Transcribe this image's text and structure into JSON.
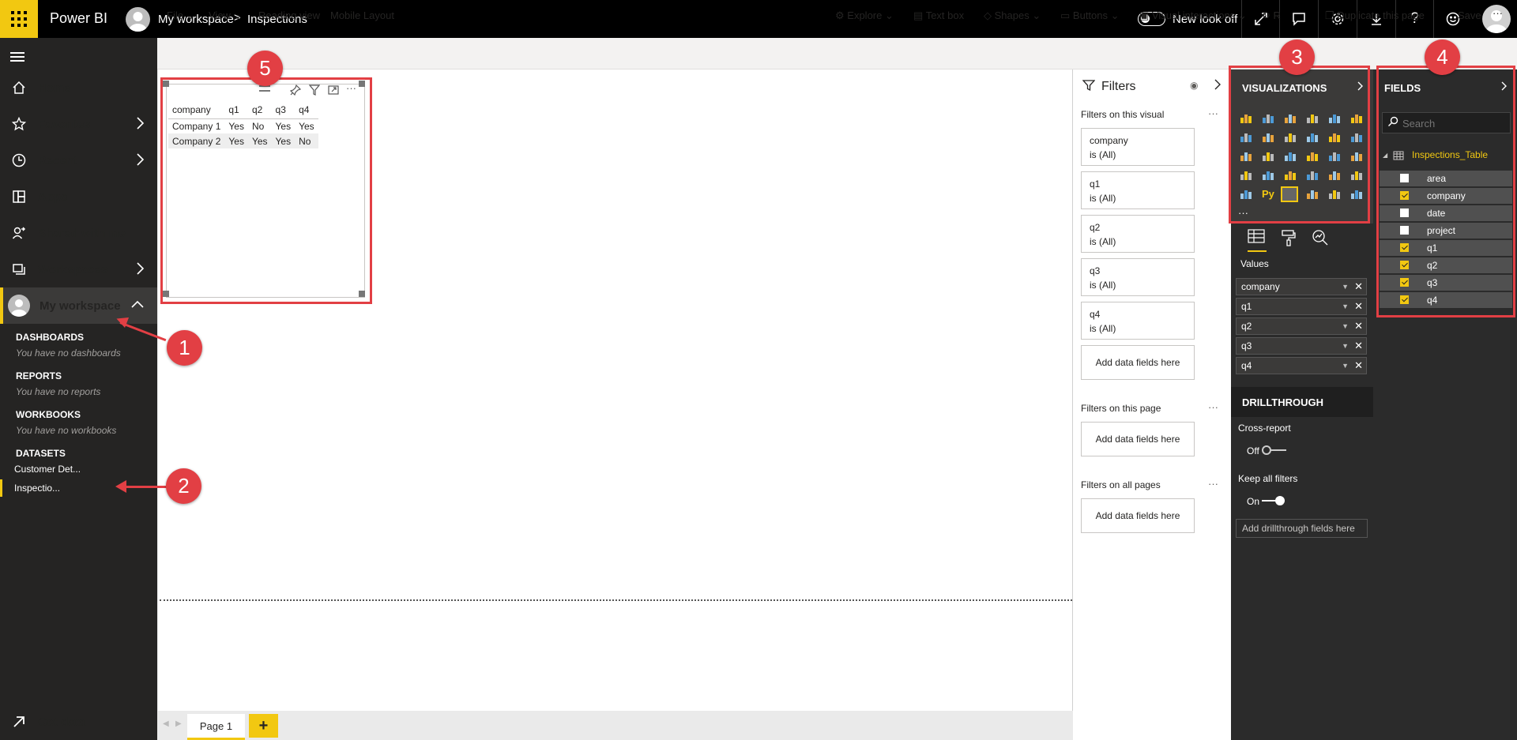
{
  "app": {
    "brand": "Power BI"
  },
  "topbar": {
    "breadcrumb_workspace": "My workspace",
    "breadcrumb_separator": ">",
    "breadcrumb_report": "Inspections",
    "new_look_label": "New look off",
    "icons": [
      "expand-icon",
      "comment-icon",
      "settings-icon",
      "download-icon",
      "help-icon",
      "feedback-smiley-icon"
    ]
  },
  "leftnav": {
    "home": "Home",
    "favorites": "Favorites",
    "recent": "Recent",
    "apps": "Apps",
    "shared": "Shared with me",
    "workspaces": "Workspaces",
    "my_workspace": "My workspace",
    "dashboards_head": "DASHBOARDS",
    "dashboards_empty": "You have no dashboards",
    "reports_head": "REPORTS",
    "reports_empty": "You have no reports",
    "workbooks_head": "WORKBOOKS",
    "workbooks_empty": "You have no workbooks",
    "datasets_head": "DATASETS",
    "datasets": [
      "Customer Det...",
      "Inspectio..."
    ],
    "get_data": "Get data"
  },
  "ribbon": {
    "file": "File",
    "view": "View",
    "reading_view": "Reading view",
    "mobile_layout": "Mobile Layout",
    "explore": "Explore",
    "text_box": "Text box",
    "shapes": "Shapes",
    "buttons": "Buttons",
    "visual_interactions": "Visual interactions",
    "refresh": "R",
    "duplicate": "Duplicate this page",
    "save": "Save",
    "more": "···"
  },
  "table_visual": {
    "columns": [
      "company",
      "q1",
      "q2",
      "q3",
      "q4"
    ],
    "rows": [
      [
        "Company 1",
        "Yes",
        "No",
        "Yes",
        "Yes"
      ],
      [
        "Company 2",
        "Yes",
        "Yes",
        "Yes",
        "No"
      ]
    ]
  },
  "filters": {
    "title": "Filters",
    "on_visual": "Filters on this visual",
    "visual_filters": [
      {
        "name": "company",
        "state": "is (All)"
      },
      {
        "name": "q1",
        "state": "is (All)"
      },
      {
        "name": "q2",
        "state": "is (All)"
      },
      {
        "name": "q3",
        "state": "is (All)"
      },
      {
        "name": "q4",
        "state": "is (All)"
      }
    ],
    "add_here": "Add data fields here",
    "on_page": "Filters on this page",
    "on_all": "Filters on all pages"
  },
  "visualizations": {
    "title": "VISUALIZATIONS",
    "py_label": "Py",
    "more": "···",
    "values_label": "Values",
    "value_fields": [
      "company",
      "q1",
      "q2",
      "q3",
      "q4"
    ],
    "drillthrough": "DRILLTHROUGH",
    "cross_report": "Cross-report",
    "cross_report_state": "Off",
    "keep_all": "Keep all filters",
    "keep_all_state": "On",
    "add_drill": "Add drillthrough fields here"
  },
  "fields": {
    "title": "FIELDS",
    "search_placeholder": "Search",
    "table_name": "Inspections_Table",
    "items": [
      {
        "name": "area",
        "checked": false
      },
      {
        "name": "company",
        "checked": true
      },
      {
        "name": "date",
        "checked": false
      },
      {
        "name": "project",
        "checked": false
      },
      {
        "name": "q1",
        "checked": true
      },
      {
        "name": "q2",
        "checked": true
      },
      {
        "name": "q3",
        "checked": true
      },
      {
        "name": "q4",
        "checked": true
      }
    ]
  },
  "pages": {
    "tab": "Page 1",
    "add": "+"
  },
  "annotations": [
    "1",
    "2",
    "3",
    "4",
    "5"
  ],
  "colors": {
    "accent_yellow": "#f2c811",
    "annotation_red": "#e23f44",
    "nav_bg": "#252423"
  }
}
